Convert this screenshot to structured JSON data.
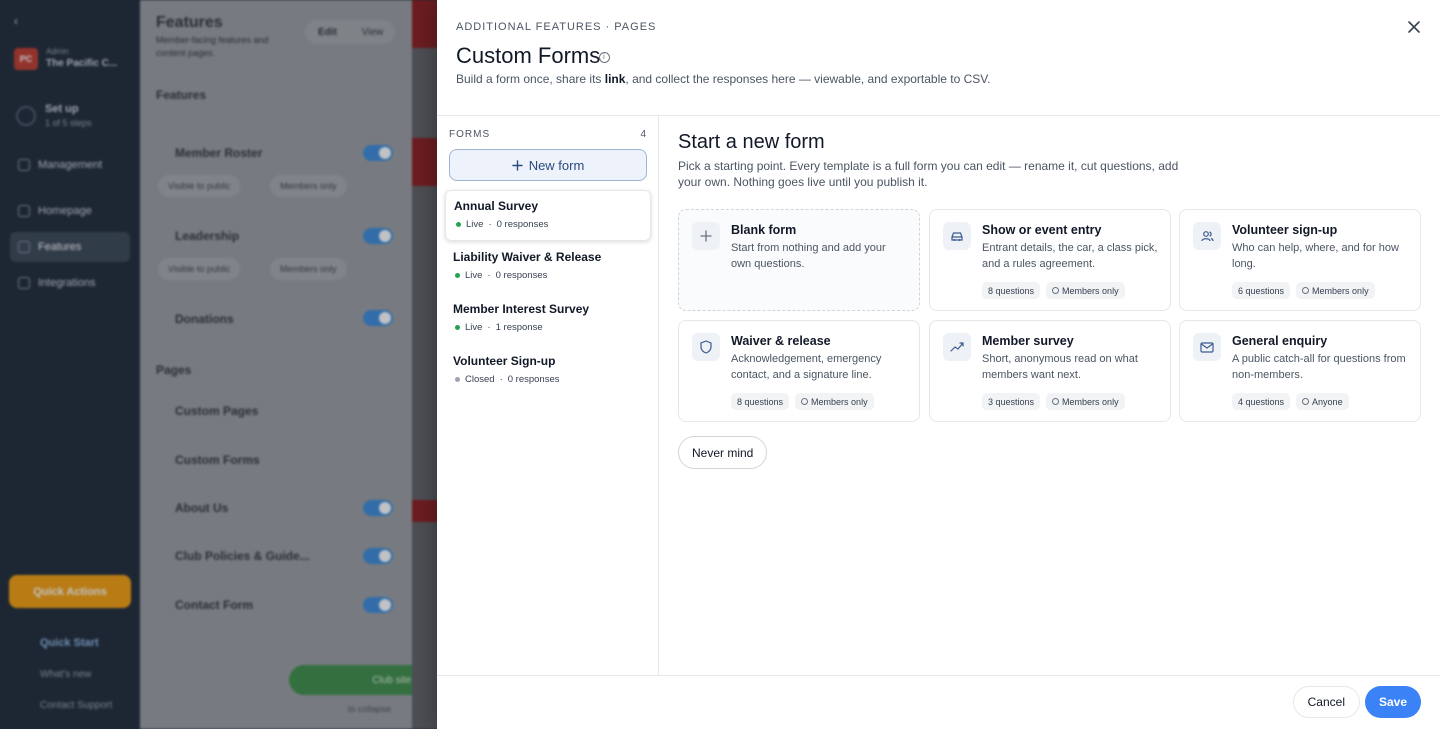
{
  "background": {
    "nav": {
      "org_initials": "PC",
      "org_label": "Admin",
      "org_name": "The Pacific C...",
      "setup_title": "Set up",
      "setup_sub": "1 of 5 steps",
      "items": [
        {
          "label": "Management"
        },
        {
          "label": "Homepage"
        },
        {
          "label": "Features"
        },
        {
          "label": "Integrations"
        }
      ],
      "quick_actions": "Quick Actions",
      "quick_start": "Quick Start",
      "whats_new": "What's new",
      "contact_support": "Contact Support"
    },
    "features_panel": {
      "title": "Features",
      "subtitle": "Member-facing features and content pages.",
      "edit": "Edit",
      "view": "View",
      "features_heading": "Features",
      "features": [
        "Member Roster",
        "Leadership",
        "Donations"
      ],
      "visible_label": "Visible to public",
      "members_label": "Members only",
      "pages_heading": "Pages",
      "pages": [
        "Custom Pages",
        "Custom Forms",
        "About Us",
        "Club Policies & Guide...",
        "Contact Form"
      ],
      "published": "Club site published",
      "collapse": "to collapse"
    }
  },
  "drawer": {
    "breadcrumb": "Additional Features · Pages",
    "title": "Custom Forms",
    "subtitle_pre": "Build a form once, share its ",
    "subtitle_link": "link",
    "subtitle_post": ", and collect the responses here — viewable, and exportable to CSV.",
    "forms_label": "Forms",
    "forms_count": "4",
    "new_form": "New form",
    "forms": [
      {
        "name": "Annual Survey",
        "status": "Live",
        "responses": "0 responses"
      },
      {
        "name": "Liability Waiver & Release",
        "status": "Live",
        "responses": "0 responses"
      },
      {
        "name": "Member Interest Survey",
        "status": "Live",
        "responses": "1 response"
      },
      {
        "name": "Volunteer Sign-up",
        "status": "Closed",
        "responses": "0 responses"
      }
    ],
    "start_title": "Start a new form",
    "start_desc": "Pick a starting point. Every template is a full form you can edit — rename it, cut questions, add your own. Nothing goes live until you publish it.",
    "templates": [
      {
        "icon": "plus-icon",
        "title": "Blank form",
        "desc": "Start from nothing and add your own questions.",
        "questions": "",
        "access": ""
      },
      {
        "icon": "car-icon",
        "title": "Show or event entry",
        "desc": "Entrant details, the car, a class pick, and a rules agreement.",
        "questions": "8 questions",
        "access": "Members only"
      },
      {
        "icon": "users-icon",
        "title": "Volunteer sign-up",
        "desc": "Who can help, where, and for how long.",
        "questions": "6 questions",
        "access": "Members only"
      },
      {
        "icon": "shield-icon",
        "title": "Waiver & release",
        "desc": "Acknowledgement, emergency contact, and a signature line.",
        "questions": "8 questions",
        "access": "Members only"
      },
      {
        "icon": "trend-icon",
        "title": "Member survey",
        "desc": "Short, anonymous read on what members want next.",
        "questions": "3 questions",
        "access": "Members only"
      },
      {
        "icon": "mail-icon",
        "title": "General enquiry",
        "desc": "A public catch-all for questions from non-members.",
        "questions": "4 questions",
        "access": "Anyone"
      }
    ],
    "never_mind": "Never mind",
    "cancel": "Cancel",
    "save": "Save"
  },
  "colors": {
    "accent": "#3b82f6",
    "live": "#22a352",
    "closed": "#9ca3af",
    "nav_bg": "#1e2935"
  }
}
